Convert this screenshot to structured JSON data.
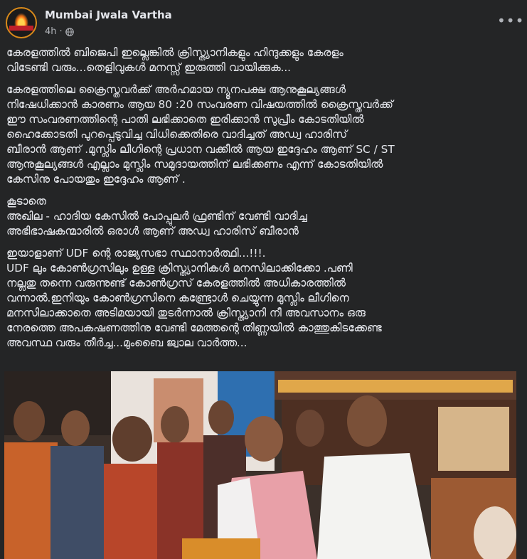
{
  "post": {
    "page_name": "Mumbai Jwala Vartha",
    "time": "4h",
    "more_label": "•••",
    "text_paragraphs": [
      [
        "കേരളത്തിൽ ബിജെപി ഇല്ലെങ്കിൽ ക്രിസ്ത്യാനികളും ഹിന്ദുക്കളും കേരളം",
        "വിടേണ്ടി വരും...തെളിവുകൾ മനസ്സ് ഇരുത്തി  വായിക്കുക..."
      ],
      [
        "കേരളത്തിലെ ക്രൈസ്തവർക്ക് അർഹമായ ന്യൂനപക്ഷ ആനുകൂല്യങ്ങൾ",
        "നിഷേധിക്കാൻ കാരണം ആയ 80 :20 സംവരണ വിഷയത്തിൽ ക്രൈസ്തവർക്ക്",
        "ഈ സംവരണത്തിന്റെ പാതി ലഭിക്കാതെ ഇരിക്കാൻ സുപ്രീം കോടതിയിൽ",
        "ഹൈക്കോടതി പുറപ്പെടുവിച്ച വിധിക്കെതിരെ വാദിച്ചത് അഡ്വ ഹാരിസ്",
        "ബീരാൻ ആണ് .മുസ്ലിം ലീഗിന്റെ പ്രധാന വക്കീൽ ആയ ഇദ്ദേഹം ആണ് SC / ST",
        "ആനുകൂല്യങ്ങൾ എല്ലാം മുസ്ലിം സമുദായത്തിന് ലഭിക്കണം എന്ന് കോടതിയിൽ",
        "കേസിനു പോയതും ഇദ്ദേഹം ആണ് ."
      ],
      [
        "കൂടാതെ",
        "അഖില - ഹാദിയ കേസിൽ പോപ്പുലർ ഫ്രണ്ടിന് വേണ്ടി വാദിച്ച",
        "അഭിഭാഷകന്മാരിൽ ഒരാൾ ആണ് അഡ്വ ഹാരിസ് ബീരാൻ"
      ],
      [
        "ഇയാളാണ് UDF ന്റെ രാജ്യസഭാ സ്ഥാനാർത്ഥി...!!!.",
        "UDF ലും കോൺഗ്രസിലും ഉള്ള ക്രിസ്ത്യാനികൾ മനസിലാക്കിക്കോ .പണി",
        "നല്ലതു തന്നെ വരുന്നുണ്ട് കോൺഗ്രസ് കേരളത്തിൽ അധികാരത്തിൽ",
        "വന്നാൽ.ഇനിയും കോൺഗ്രസിനെ കണ്ട്രോൾ ചെയ്യുന്ന മുസ്ലിം ലീഗിനെ",
        "മനസിലാക്കാതെ അടിമയായി തുടർന്നാൽ ക്രിസ്ത്യാനി നീ അവസാനം ഒരു",
        "നേരത്തെ അപകഷണത്തിനു വേണ്ടി മേത്തന്റെ തിണ്ണയിൽ കാത്തുകിടക്കേണ്ട",
        "അവസ്ഥ വരും തീർച്ച...മുംബൈ ജ്വാല വാർത്ത..."
      ]
    ]
  },
  "icons": {
    "globe": "globe-icon",
    "more": "more-options-icon",
    "avatar": "page-logo"
  },
  "colors": {
    "background": "#242526",
    "text": "#e4e6eb",
    "secondary_text": "#b0b3b8"
  }
}
